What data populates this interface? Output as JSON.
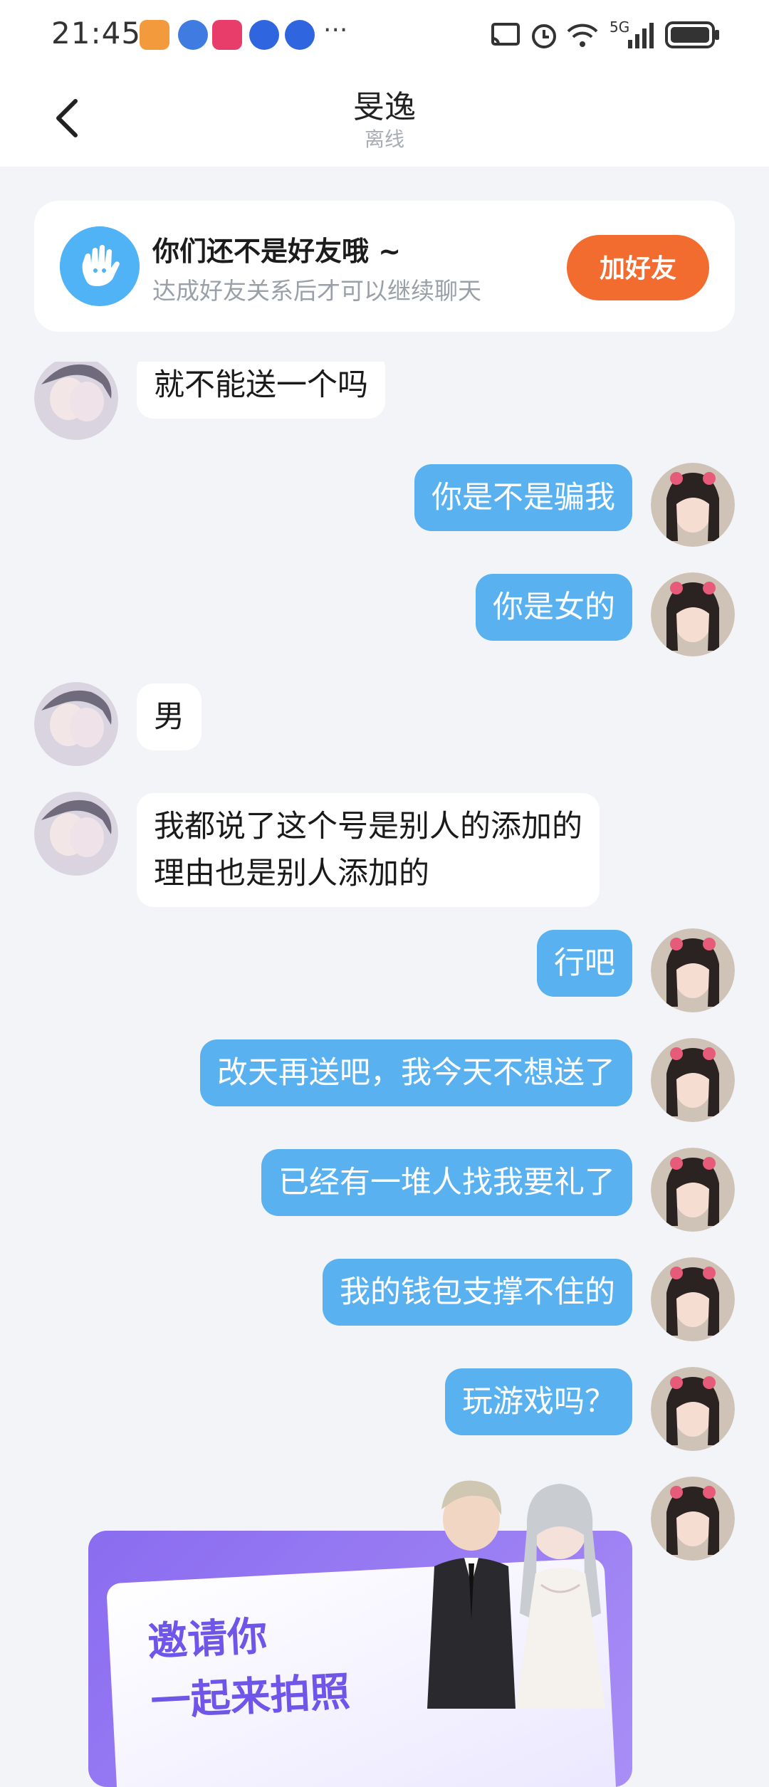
{
  "status_bar": {
    "time": "21:45",
    "more": "···",
    "network": "5G"
  },
  "header": {
    "title": "旻逸",
    "subtitle": "离线"
  },
  "notice": {
    "title": "你们还不是好友哦 ~",
    "description": "达成好友关系后才可以继续聊天",
    "button": "加好友"
  },
  "messages": [
    {
      "side": "in",
      "text": "就不能送一个吗"
    },
    {
      "side": "out",
      "text": "你是不是骗我"
    },
    {
      "side": "out",
      "text": "你是女的"
    },
    {
      "side": "in",
      "text": "男"
    },
    {
      "side": "in",
      "lines": [
        "我都说了这个号是别人的添加的",
        "理由也是别人添加的"
      ]
    },
    {
      "side": "out",
      "text": "行吧"
    },
    {
      "side": "out",
      "text": "改天再送吧，我今天不想送了"
    },
    {
      "side": "out",
      "text": "已经有一堆人找我要礼了"
    },
    {
      "side": "out",
      "text": "我的钱包支撑不住的"
    },
    {
      "side": "out",
      "text": "玩游戏吗？"
    }
  ],
  "promo": {
    "line1": "邀请你",
    "line2": "一起来拍照"
  },
  "colors": {
    "accent_orange": "#f26b2f",
    "bubble_out": "#5ab1f0",
    "bubble_in": "#ffffff",
    "background": "#f2f4f8"
  }
}
